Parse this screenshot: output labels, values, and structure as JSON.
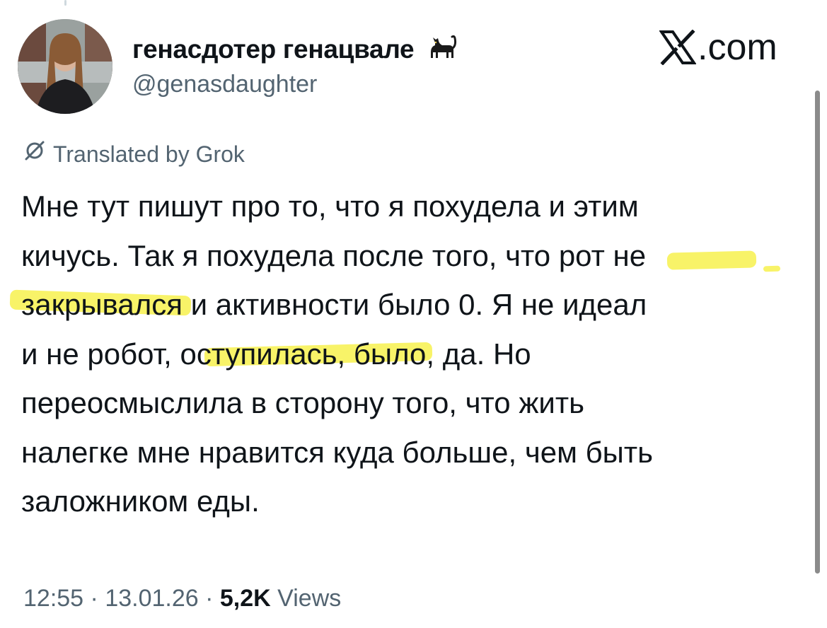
{
  "author": {
    "display_name": "генасдотер генацвале",
    "handle": "@genasdaughter",
    "avatar_icon": "profile-photo",
    "name_emoji_icon": "black-cat-icon"
  },
  "brand": {
    "icon": "x-logo-icon",
    "label": ".com"
  },
  "translation": {
    "icon": "translate-slash-icon",
    "label": "Translated by Grok"
  },
  "tweet": {
    "lines": [
      "Мне тут пишут про то, что я похудела и этим",
      "кичусь. Так я похудела после того, что рот не",
      "закрывался и активности было 0. Я не идеал",
      "и не робот, оступилась, было, да. Но",
      "переосмыслила в сторону того, что жить",
      "налегке мне нравится куда больше, чем быть",
      "заложником еды."
    ],
    "highlight_color": "#f6ef3d"
  },
  "meta": {
    "time": "12:55",
    "separator1": " · ",
    "date": "13.01.26",
    "separator2": " · ",
    "views_count": "5,2K",
    "views_label": " Views"
  }
}
